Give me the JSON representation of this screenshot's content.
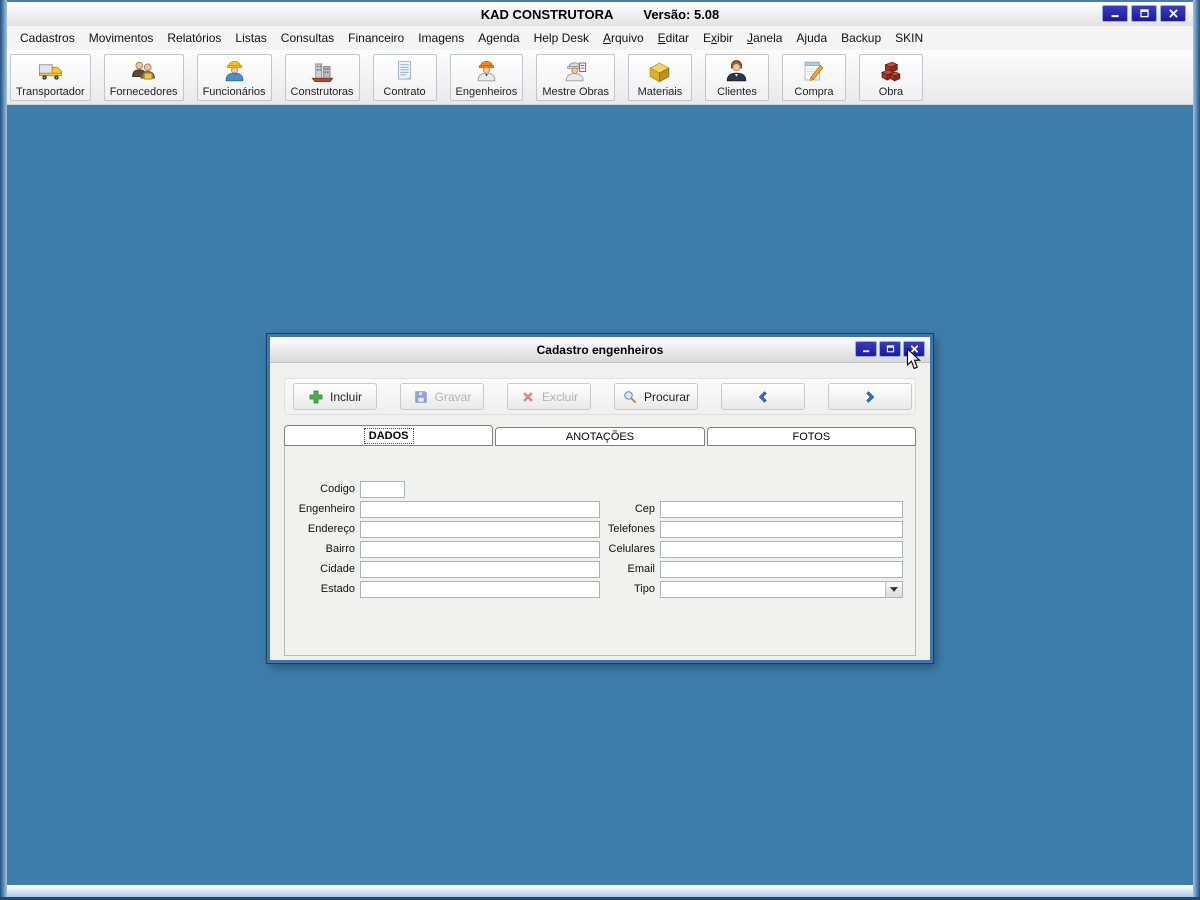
{
  "window": {
    "title": "KAD CONSTRUTORA",
    "version": "Versão: 5.08",
    "controls": [
      {
        "name": "minimize"
      },
      {
        "name": "maximize"
      },
      {
        "name": "close"
      }
    ]
  },
  "menu": {
    "items": [
      {
        "label": "Cadastros"
      },
      {
        "label": "Movimentos"
      },
      {
        "label": "Relatórios"
      },
      {
        "label": "Listas"
      },
      {
        "label": "Consultas"
      },
      {
        "label": "Financeiro"
      },
      {
        "label": "Imagens"
      },
      {
        "label": "Agenda"
      },
      {
        "label": "Help Desk"
      },
      {
        "label": "Arquivo",
        "accel": 0
      },
      {
        "label": "Editar",
        "accel": 0
      },
      {
        "label": "Exibir",
        "accel": 1
      },
      {
        "label": "Janela",
        "accel": 0
      },
      {
        "label": "Ajuda"
      },
      {
        "label": "Backup"
      },
      {
        "label": "SKIN"
      }
    ]
  },
  "toolbar": {
    "buttons": [
      {
        "label": "Transportador",
        "icon": "truck-icon"
      },
      {
        "label": "Fornecedores",
        "icon": "suppliers-icon"
      },
      {
        "label": "Funcionários",
        "icon": "worker-icon"
      },
      {
        "label": "Construtoras",
        "icon": "building-icon"
      },
      {
        "label": "Contrato",
        "icon": "contract-icon"
      },
      {
        "label": "Engenheiros",
        "icon": "engineer-icon"
      },
      {
        "label": "Mestre Obras",
        "icon": "foreman-icon"
      },
      {
        "label": "Materiais",
        "icon": "materials-box-icon"
      },
      {
        "label": "Clientes",
        "icon": "client-icon"
      },
      {
        "label": "Compra",
        "icon": "purchase-note-icon"
      },
      {
        "label": "Obra",
        "icon": "bricks-icon"
      }
    ]
  },
  "dialog": {
    "title": "Cadastro engenheiros",
    "controls": [
      {
        "name": "minimize"
      },
      {
        "name": "maximize"
      },
      {
        "name": "close"
      }
    ],
    "actions": [
      {
        "name": "incluir-button",
        "label": "Incluir",
        "icon": "plus-icon",
        "enabled": true
      },
      {
        "name": "gravar-button",
        "label": "Gravar",
        "icon": "save-floppy-icon",
        "enabled": false
      },
      {
        "name": "excluir-button",
        "label": "Excluir",
        "icon": "delete-x-icon",
        "enabled": false
      },
      {
        "name": "procurar-button",
        "label": "Procurar",
        "icon": "search-icon",
        "enabled": true
      },
      {
        "name": "previous-button",
        "label": "",
        "icon": "chevron-left-icon",
        "enabled": true
      },
      {
        "name": "next-button",
        "label": "",
        "icon": "chevron-right-icon",
        "enabled": true
      }
    ],
    "tabs": [
      {
        "label": "DADOS",
        "active": true
      },
      {
        "label": "ANOTAÇÕES",
        "active": false
      },
      {
        "label": "FOTOS",
        "active": false
      }
    ],
    "form": {
      "left": [
        {
          "label": "Codigo",
          "value": "",
          "size": "narrow"
        },
        {
          "label": "Engenheiro",
          "value": ""
        },
        {
          "label": "Endereço",
          "value": ""
        },
        {
          "label": "Bairro",
          "value": ""
        },
        {
          "label": "Cidade",
          "value": ""
        },
        {
          "label": "Estado",
          "value": ""
        }
      ],
      "right": [
        {
          "label": "Cep",
          "value": ""
        },
        {
          "label": "Telefones",
          "value": ""
        },
        {
          "label": "Celulares",
          "value": ""
        },
        {
          "label": "Email",
          "value": ""
        },
        {
          "label": "Tipo",
          "value": "",
          "type": "select"
        }
      ]
    }
  },
  "colors": {
    "desktop": "#3E7DAB",
    "window_button_blue": "#1B1B96",
    "frame_blue": "#5586B5"
  }
}
